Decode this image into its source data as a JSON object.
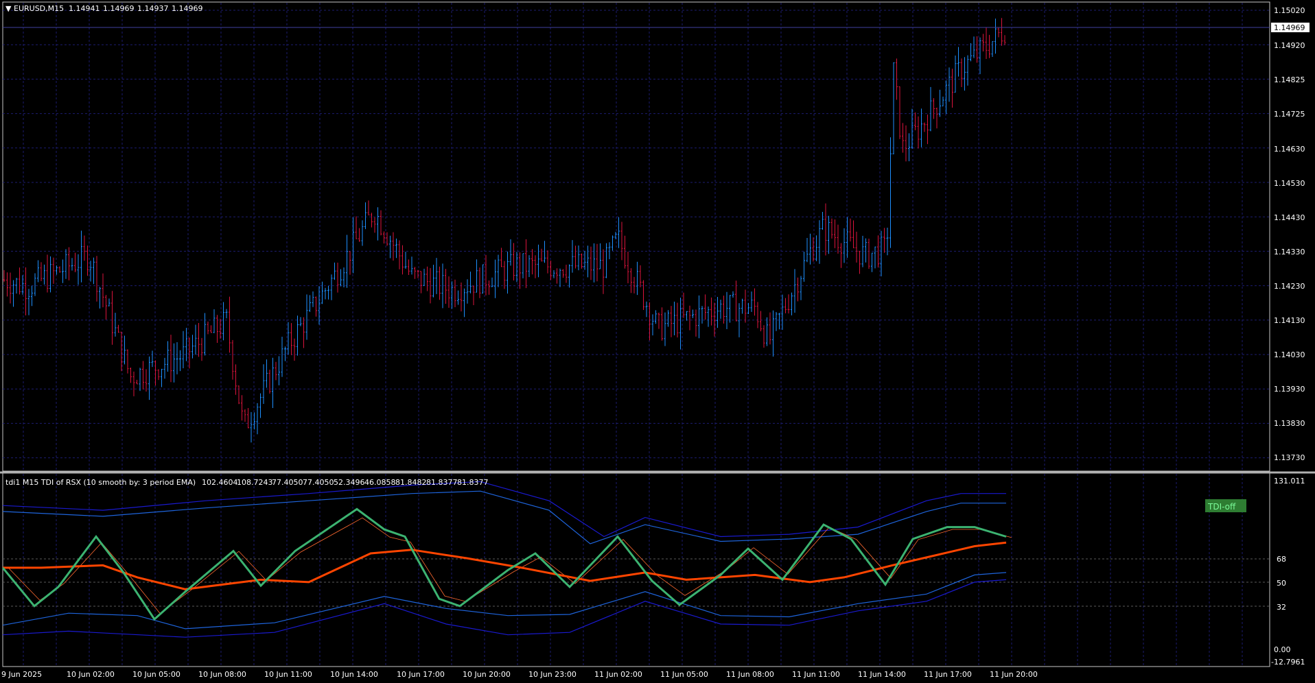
{
  "main_chart": {
    "symbol": "EURUSD,M15",
    "ohlc": [
      "1.14941",
      "1.14969",
      "1.14937",
      "1.14969"
    ],
    "current_price": "1.14969",
    "price_ticks": [
      "1.15020",
      "1.14920",
      "1.14825",
      "1.14725",
      "1.14630",
      "1.14530",
      "1.14430",
      "1.14330",
      "1.14230",
      "1.14130",
      "1.14030",
      "1.13930",
      "1.13830",
      "1.13730"
    ],
    "candles": "Vertical bars; price path: 1.1428 → 1.1400 (low) → 1.1440 → 1.1428 → 1.1433 → 1.1405 → 1.1444 → 1.1430 → 1.1490 (spike) → 1.14969"
  },
  "indicator": {
    "title": "tdi1 M15 TDI of RSX (10 smooth by: 3 period EMA)",
    "values": [
      "102.4604",
      "108.7243",
      "77.4050",
      "77.4050",
      "52.3496",
      "46.0858",
      "81.8482",
      "81.8377",
      "81.8377"
    ],
    "badge": "TDI-off",
    "ticks": [
      "131.011",
      "68",
      "50",
      "32",
      "0.00",
      "-12.7961"
    ]
  },
  "time_axis": [
    "9 Jun 2025",
    "10 Jun 02:00",
    "10 Jun 05:00",
    "10 Jun 08:00",
    "10 Jun 11:00",
    "10 Jun 14:00",
    "10 Jun 17:00",
    "10 Jun 20:00",
    "10 Jun 23:00",
    "11 Jun 02:00",
    "11 Jun 05:00",
    "11 Jun 08:00",
    "11 Jun 11:00",
    "11 Jun 14:00",
    "11 Jun 17:00",
    "11 Jun 20:00"
  ],
  "colors": {
    "up": "#1e90ff",
    "down": "#dc143c",
    "grid": "#1c1c70",
    "tdi_fast": "#3cb371",
    "tdi_slow": "#ff4500",
    "bands": "#1e64dc",
    "badge_bg": "#2e7d32"
  }
}
